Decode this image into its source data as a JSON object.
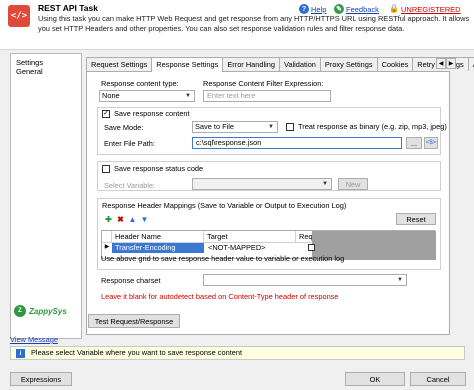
{
  "header": {
    "logo_glyph": "</>",
    "title": "REST API Task",
    "description": "Using this task you can make HTTP Web Request and get response from any HTTP/HTTPS URL using RESTful approach. It allows you set HTTP Headers and other properties. You can also set response validation rules and filter response data.",
    "help_label": "Help",
    "feedback_label": "Feedback",
    "unregistered_label": "UNREGISTERED",
    "help_icon": "help-icon",
    "feedback_icon": "feedback-icon",
    "lock_icon": "lock-icon"
  },
  "sidebar": {
    "items": [
      {
        "label": "Settings"
      },
      {
        "label": "General"
      }
    ],
    "brand": "ZappySys"
  },
  "tabs": [
    {
      "label": "Request Settings"
    },
    {
      "label": "Response Settings",
      "active": true
    },
    {
      "label": "Error Handling"
    },
    {
      "label": "Validation"
    },
    {
      "label": "Proxy Settings"
    },
    {
      "label": "Cookies"
    },
    {
      "label": "Retry Settings"
    },
    {
      "label": "A"
    }
  ],
  "response": {
    "content_type_label": "Response content type:",
    "content_type_value": "None",
    "filter_label": "Response Content Filter Expression:",
    "filter_placeholder": "Enter text here",
    "filter_button": "..."
  },
  "save_response": {
    "checkbox_label": "Save response content",
    "checked": true,
    "mode_label": "Save Mode:",
    "mode_value": "Save to File",
    "binary_label": "Treat response as binary (e.g. zip, mp3, jpeg)",
    "binary_checked": false,
    "file_path_label": "Enter File Path:",
    "file_path_value": "c:\\sql\\response.json",
    "browse_button": "...",
    "variable_button": "<$>"
  },
  "status_code": {
    "checkbox_label": "Save response status code",
    "checked": false,
    "variable_label": "Select Variable:",
    "new_button": "New"
  },
  "header_mappings": {
    "title": "Response Header Mappings (Save to Variable or Output to Execution Log)",
    "reset_button": "Reset",
    "columns": [
      "Header Name",
      "Target",
      "Require"
    ],
    "rows": [
      {
        "header_name": "Transfer-Encoding",
        "target": "<NOT-MAPPED>",
        "required": false
      }
    ],
    "hint": "Use above grid to save response header value to variable or execution log"
  },
  "charset": {
    "label": "Response charset",
    "hint": "Leave it blank for autodetect based on Content-Type header of response"
  },
  "test_button": "Test Request/Response",
  "view_message": "View Message",
  "status_message": "Please select Variable where you want to save response content",
  "footer": {
    "expressions": "Expressions",
    "ok": "OK",
    "cancel": "Cancel"
  }
}
